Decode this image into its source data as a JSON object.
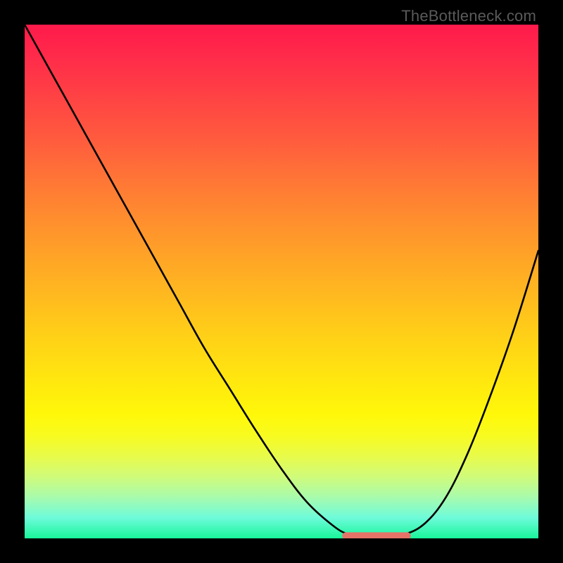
{
  "attribution": "TheBottleneck.com",
  "colors": {
    "frame": "#000000",
    "curve": "#000000",
    "marker_fill": "#e57368",
    "marker_stroke": "#c6584f"
  },
  "chart_data": {
    "type": "line",
    "title": "",
    "xlabel": "",
    "ylabel": "",
    "xlim": [
      0,
      100
    ],
    "ylim": [
      0,
      100
    ],
    "grid": false,
    "legend": false,
    "series": [
      {
        "name": "bottleneck-curve",
        "x": [
          0,
          5,
          10,
          15,
          20,
          25,
          30,
          35,
          40,
          45,
          50,
          55,
          60,
          63,
          66,
          70,
          74,
          78,
          82,
          86,
          90,
          95,
          100
        ],
        "values": [
          100,
          91,
          82,
          73,
          64,
          55,
          46,
          37,
          29,
          21,
          13.5,
          7,
          2.5,
          0.8,
          0.5,
          0.5,
          0.8,
          3,
          8,
          16,
          26,
          40,
          56
        ]
      }
    ],
    "annotations": [
      {
        "name": "optimal-range-marker",
        "type": "segment",
        "x0": 62.5,
        "x1": 74.5,
        "y": 0.5
      }
    ]
  }
}
